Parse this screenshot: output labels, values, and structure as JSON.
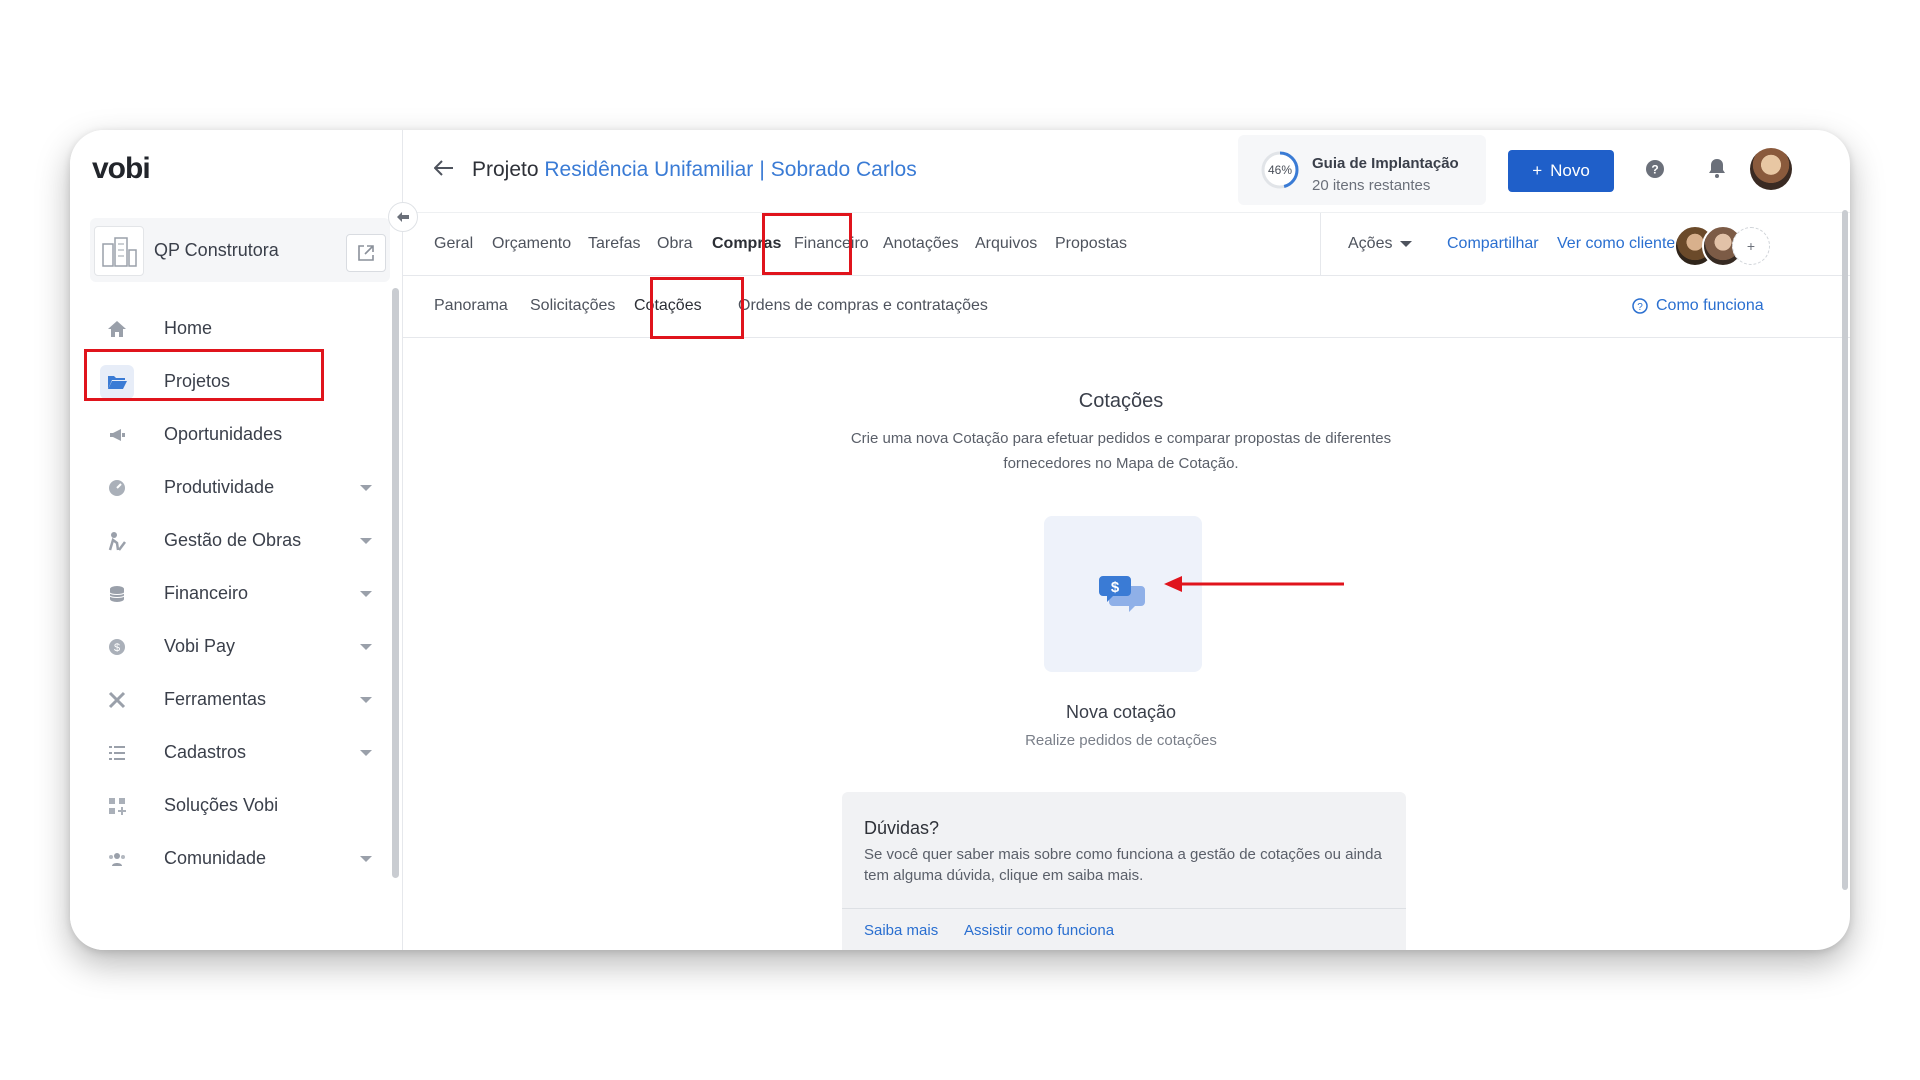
{
  "app": {
    "logo": "vobi"
  },
  "company": {
    "name": "QP Construtora"
  },
  "sidebar": {
    "items": [
      {
        "label": "Home",
        "icon": "home-icon"
      },
      {
        "label": "Projetos",
        "icon": "folder-icon"
      },
      {
        "label": "Oportunidades",
        "icon": "megaphone-icon"
      },
      {
        "label": "Produtividade",
        "icon": "gauge-icon"
      },
      {
        "label": "Gestão de Obras",
        "icon": "worker-icon"
      },
      {
        "label": "Financeiro",
        "icon": "coins-icon"
      },
      {
        "label": "Vobi Pay",
        "icon": "dollar-coin-icon"
      },
      {
        "label": "Ferramentas",
        "icon": "tools-icon"
      },
      {
        "label": "Cadastros",
        "icon": "list-icon"
      },
      {
        "label": "Soluções Vobi",
        "icon": "apps-icon"
      },
      {
        "label": "Comunidade",
        "icon": "people-icon"
      }
    ]
  },
  "header": {
    "prefix": "Projeto",
    "project": "Residência Unifamiliar",
    "separator": "|",
    "client": "Sobrado Carlos",
    "guide": {
      "percent": "46%",
      "progress": 0.46,
      "title": "Guia de Implantação",
      "subtitle": "20 itens restantes"
    },
    "new_button": "Novo"
  },
  "tabs": {
    "items": [
      "Geral",
      "Orçamento",
      "Tarefas",
      "Obra",
      "Compras",
      "Financeiro",
      "Anotações",
      "Arquivos",
      "Propostas"
    ],
    "selected": "Compras",
    "actions": "Ações",
    "share": "Compartilhar",
    "view_as_client": "Ver como cliente",
    "team_more": "+"
  },
  "subtabs": {
    "items": [
      "Panorama",
      "Solicitações",
      "Cotações",
      "Ordens de compras e contratações"
    ],
    "selected": "Cotações",
    "help": "Como funciona"
  },
  "content": {
    "title": "Cotações",
    "description": "Crie uma nova Cotação para efetuar pedidos e comparar propostas de diferentes fornecedores no Mapa de Cotação.",
    "card_title": "Nova cotação",
    "card_subtitle": "Realize pedidos de cotações",
    "faq": {
      "title": "Dúvidas?",
      "text": "Se você quer saber mais sobre como funciona a gestão de cotações ou ainda tem alguma dúvida, clique em saiba mais.",
      "link1": "Saiba mais",
      "link2": "Assistir como funciona"
    }
  },
  "colors": {
    "accent": "#1f5fc9",
    "link": "#2a6fd0",
    "highlight": "#e0141c"
  }
}
